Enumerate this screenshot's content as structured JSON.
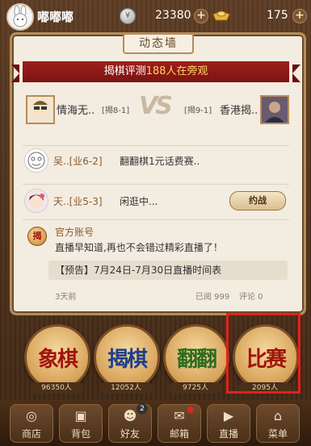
{
  "header": {
    "username": "嘟嘟嘟",
    "coins": "23380",
    "ingots": "175"
  },
  "feed": {
    "title": "动态墙",
    "live_banner": {
      "prefix": "揭棋评测",
      "count": "188人在旁观"
    },
    "match": {
      "left_name": "情海无..",
      "left_rank": "[揭8-1]",
      "vs": "VS",
      "right_rank": "[揭9-1]",
      "right_name": "香港揭.."
    },
    "items": [
      {
        "name": "吴..[业6-2]",
        "text": "翻翻棋1元话费赛.."
      },
      {
        "name": "天..[业5-3]",
        "text": "闲逛中...",
        "button": "约战"
      }
    ],
    "official": {
      "icon_text": "揭",
      "name": "官方账号",
      "text": "直播早知道,再也不会错过精彩直播了！",
      "notice": "【预告】7月24日-7月30日直播时间表",
      "time": "3天前",
      "reads": "已阅 999",
      "comments": "评论 0"
    }
  },
  "games": [
    {
      "label": "象棋",
      "players": "96350人",
      "color": "#a1140c"
    },
    {
      "label": "揭棋",
      "players": "12052人",
      "color": "#1d3f8a"
    },
    {
      "label": "翻翻",
      "players": "9725人",
      "color": "#2e6b1f"
    },
    {
      "label": "比赛",
      "players": "2095人",
      "color": "#a1140c"
    }
  ],
  "nav": [
    {
      "label": "商店",
      "icon": "shop-icon"
    },
    {
      "label": "背包",
      "icon": "backpack-icon"
    },
    {
      "label": "好友",
      "icon": "friends-icon",
      "badge": "2"
    },
    {
      "label": "邮箱",
      "icon": "mail-icon"
    },
    {
      "label": "直播",
      "icon": "live-icon"
    },
    {
      "label": "菜单",
      "icon": "menu-icon"
    }
  ]
}
